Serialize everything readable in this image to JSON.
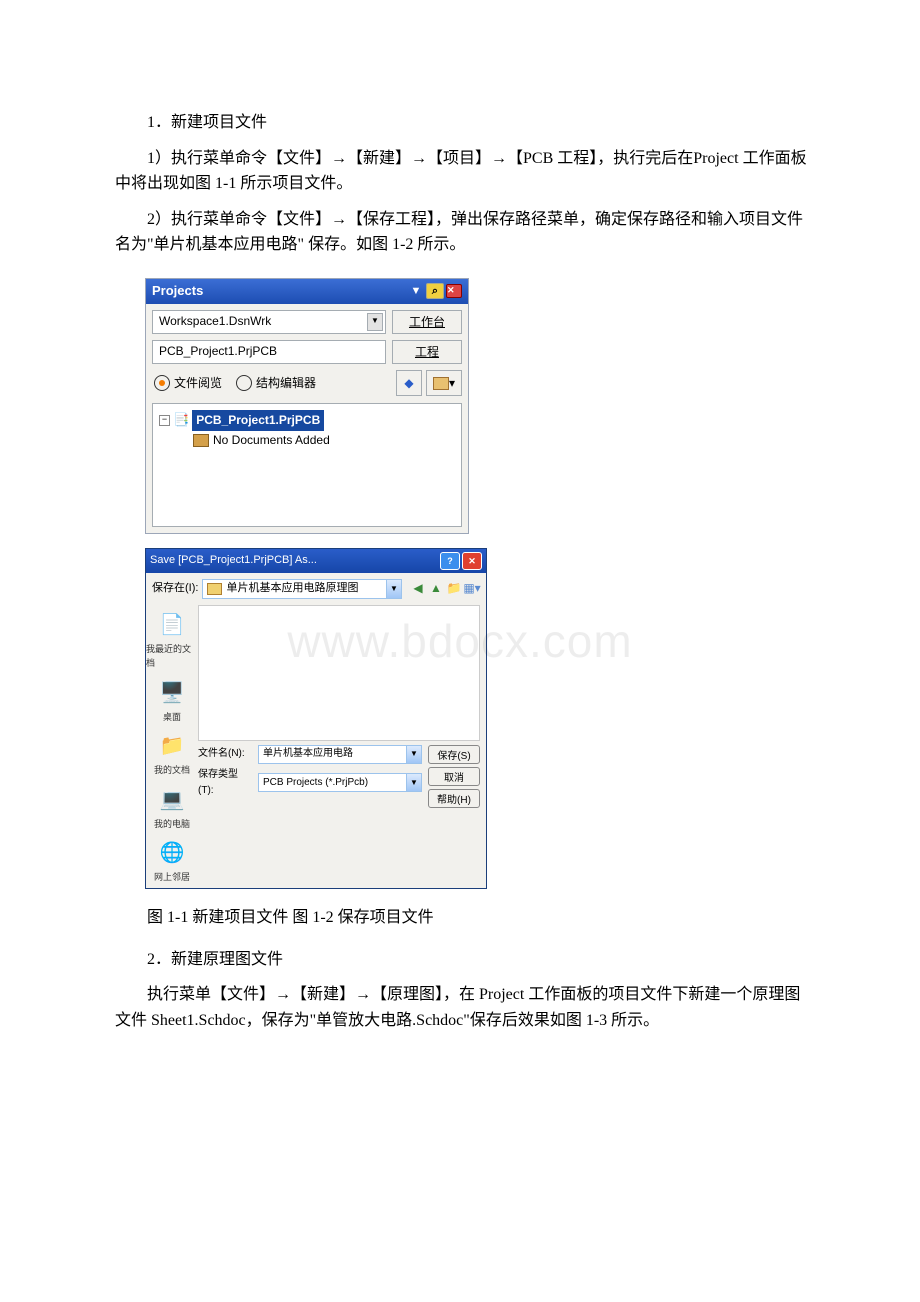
{
  "doc": {
    "h1": "1．新建项目文件",
    "p1": "1）执行菜单命令【文件】→【新建】→【项目】→【PCB 工程】，执行完后在Project 工作面板中将出现如图 1-1 所示项目文件。",
    "p2": "2）执行菜单命令【文件】→【保存工程】，弹出保存路径菜单，确定保存路径和输入项目文件名为\"单片机基本应用电路\" 保存。如图 1-2 所示。",
    "caption": "图 1-1 新建项目文件 图 1-2 保存项目文件",
    "h2": "2．新建原理图文件",
    "p3": "执行菜单【文件】→【新建】→【原理图】，在 Project 工作面板的项目文件下新建一个原理图文件 Sheet1.Schdoc，保存为\"单管放大电路.Schdoc\"保存后效果如图 1-3 所示。"
  },
  "panel": {
    "title": "Projects",
    "workspace": "Workspace1.DsnWrk",
    "workspace_btn": "工作台",
    "project": "PCB_Project1.PrjPCB",
    "project_btn": "工程",
    "radio1": "文件阅览",
    "radio2": "结构编辑器",
    "tree_root": "PCB_Project1.PrjPCB",
    "tree_child": "No Documents Added"
  },
  "save": {
    "title": "Save [PCB_Project1.PrjPCB] As...",
    "save_in_label": "保存在(I):",
    "save_in_value": "单片机基本应用电路原理图",
    "sidebar": [
      "我最近的文档",
      "桌面",
      "我的文档",
      "我的电脑",
      "网上邻居"
    ],
    "filename_label": "文件名(N):",
    "filename_value": "单片机基本应用电路",
    "filetype_label": "保存类型(T):",
    "filetype_value": "PCB Projects (*.PrjPcb)",
    "btn_save": "保存(S)",
    "btn_cancel": "取消",
    "btn_help": "帮助(H)"
  },
  "watermark": "www.bdocx.com"
}
